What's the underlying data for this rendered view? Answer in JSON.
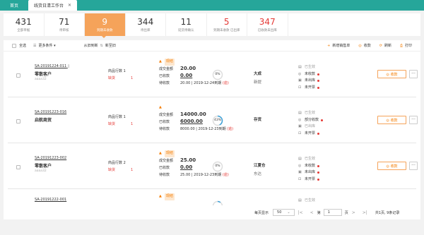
{
  "tabs": {
    "home": "首页",
    "active": "线货日清工作台",
    "close": "✕"
  },
  "stats": [
    {
      "num": "431",
      "label": "全部单据"
    },
    {
      "num": "71",
      "label": "待审核"
    },
    {
      "num": "9",
      "label": "到期未收款"
    },
    {
      "num": "344",
      "label": "待出库"
    },
    {
      "num": "11",
      "label": "延货待确认"
    },
    {
      "num": "5",
      "label": "到期未收款 已出库"
    },
    {
      "num": "347",
      "label": "已收款未出库"
    }
  ],
  "toolbar": {
    "select_all": "全选",
    "more_filters": "更多条件 ▾",
    "sort_label": "从旧到新",
    "sort_alt": "新至旧",
    "new_order": "新增销售单",
    "collect": "收款",
    "refresh": "刷新",
    "print": "打印"
  },
  "rows": [
    {
      "order_no": "SA-20191224-011",
      "customer": "零散客户",
      "user": "aaaa32",
      "lines_label": "商品行数",
      "lines_count": "1",
      "pending_label": "缺货",
      "pending_count": "1",
      "warn": "现结",
      "deal_label": "成交金额",
      "deal": "20.00",
      "paid_label": "已收款",
      "paid": "0.00",
      "due_label": "待收款",
      "due_text": "20.00 | 2019-12-24到期",
      "due_tag": "逾",
      "progress_text": "0%",
      "progress": 0,
      "warehouse": "大成",
      "warehouse_sub": "新提",
      "st1": "已生效",
      "st2": "未收款",
      "st3": "未出库",
      "st4": "未开票",
      "collect_btn": "◎ 收款",
      "more_btn": "···"
    },
    {
      "order_no": "SA-20191223-016",
      "customer": "启航商贸",
      "user": "",
      "lines_label": "商品行数",
      "lines_count": "1",
      "pending_label": "缺货",
      "pending_count": "1",
      "warn": "",
      "deal_label": "成交金额",
      "deal": "14000.00",
      "paid_label": "已收款",
      "paid": "6000.00",
      "due_label": "待收款",
      "due_text": "8000.00 | 2019-12-23到期",
      "due_tag": "逾",
      "progress_text": "43%",
      "progress": 0.43,
      "warehouse": "存货",
      "warehouse_sub": "",
      "st1": "已生效",
      "st2": "部分收款",
      "st3": "已出库",
      "st4": "未开票",
      "collect_btn": "◎ 收款",
      "more_btn": "···"
    },
    {
      "order_no": "SA-20191223-002",
      "customer": "零散客户",
      "user": "aaaa32",
      "lines_label": "商品行数",
      "lines_count": "2",
      "pending_label": "缺货",
      "pending_count": "1",
      "warn": "现结",
      "deal_label": "成交金额",
      "deal": "25.00",
      "paid_label": "已收款",
      "paid": "0.00",
      "due_label": "待收款",
      "due_text": "25.00 | 2019-12-23到期",
      "due_tag": "逾",
      "progress_text": "0%",
      "progress": 0,
      "warehouse": "江夏仓",
      "warehouse_sub": "东达",
      "st1": "已生效",
      "st2": "未收款",
      "st3": "未出库",
      "st4": "未开票",
      "collect_btn": "◎ 收款",
      "more_btn": "···"
    },
    {
      "order_no": "SA-20191222-001",
      "warn": "现结",
      "progress": 0.1,
      "st1": "已生效"
    }
  ],
  "pager": {
    "per_page_label": "每页显示",
    "per_page": "50",
    "page": "1",
    "total": "共1页, 9条记录"
  }
}
